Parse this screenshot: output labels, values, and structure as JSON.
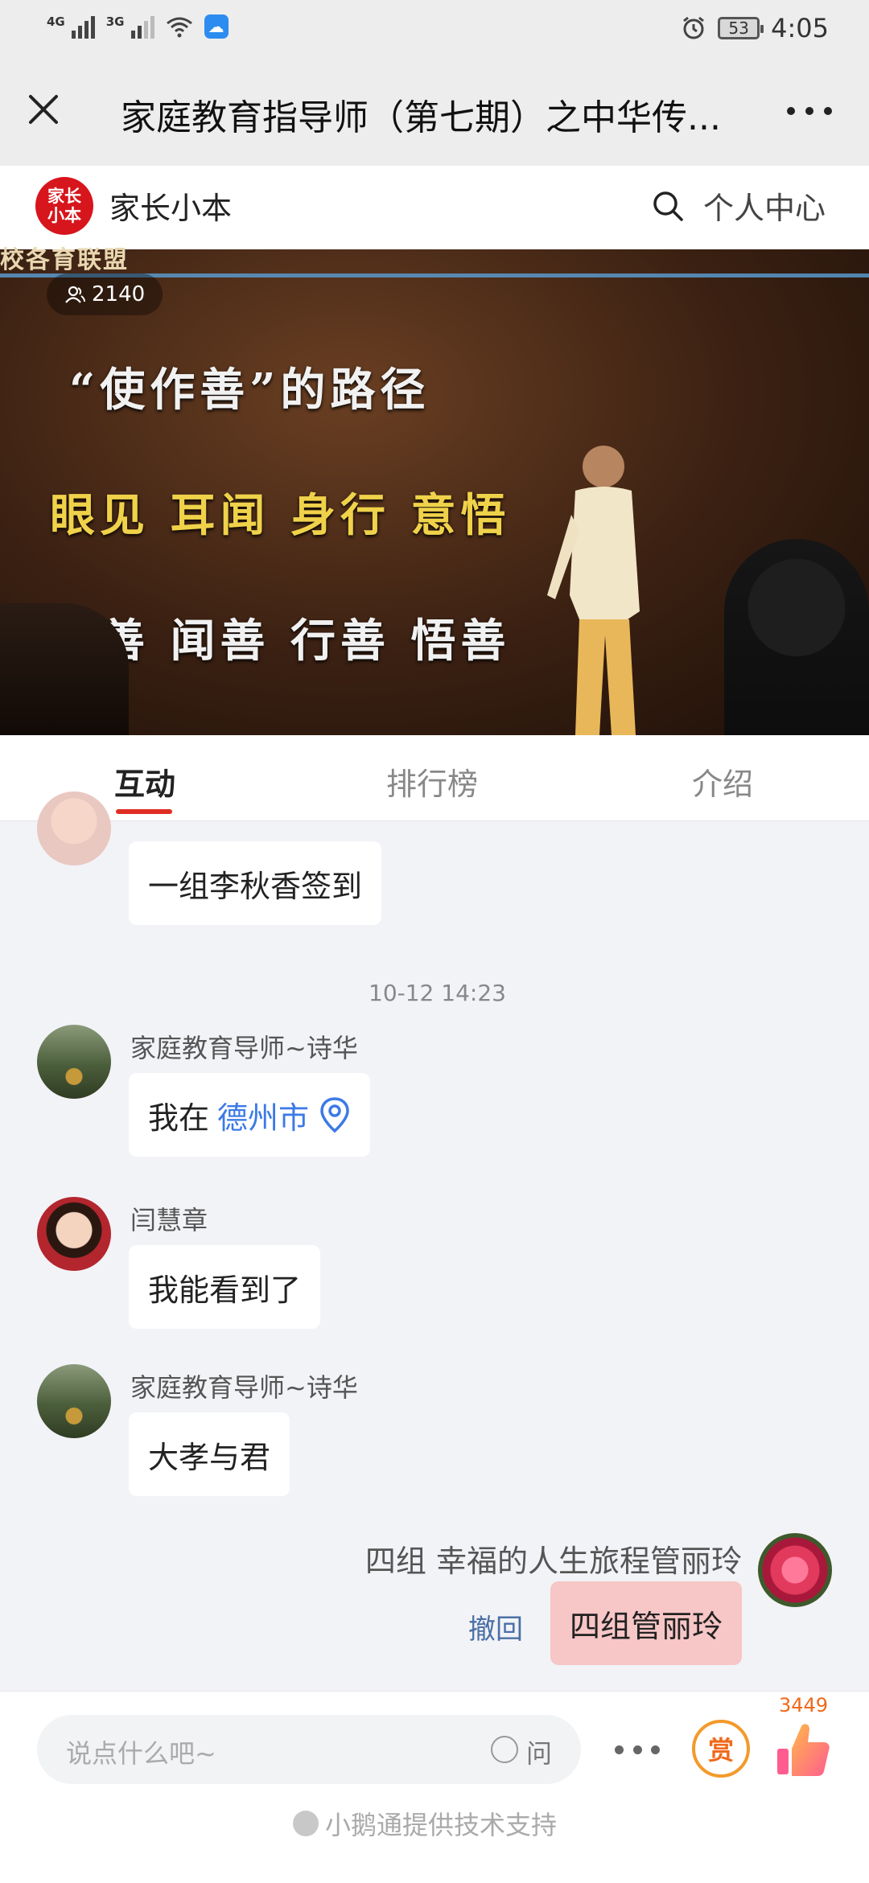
{
  "status_bar": {
    "network_1": "4G",
    "network_2": "3G",
    "battery": "53",
    "time": "4:05"
  },
  "title_bar": {
    "title": "家庭教育指导师（第七期）之中华传..."
  },
  "shop": {
    "logo_text": "家长小本",
    "name": "家长小本",
    "personal_center": "个人中心"
  },
  "video": {
    "viewers": "2140",
    "slide_top": "校各育联盟",
    "slide_line1": "“使作善”的路径",
    "slide_line2": "眼见 耳闻 身行 意悟",
    "slide_line3": "见善 闻善 行善 悟善"
  },
  "tabs": [
    {
      "label": "互动"
    },
    {
      "label": "排行榜"
    },
    {
      "label": "介绍"
    }
  ],
  "chat": {
    "messages": [
      {
        "name": "",
        "text": "一组李秋香签到"
      },
      {
        "timestamp": "10-12 14:23"
      },
      {
        "name": "家庭教育导师~诗华",
        "text": "我在",
        "location": "德州市"
      },
      {
        "name": "闫慧章",
        "text": "我能看到了"
      },
      {
        "name": "家庭教育导师~诗华",
        "text": "大孝与君"
      },
      {
        "name": "四组 幸福的人生旅程管丽玲",
        "text": "四组管丽玲",
        "recall": "撤回"
      }
    ]
  },
  "bottom_bar": {
    "placeholder": "说点什么吧~",
    "ask_label": "问",
    "reward_label": "赏",
    "like_count": "3449",
    "footer": "小鹅通提供技术支持"
  },
  "colors": {
    "accent_red": "#e02e24",
    "link_blue": "#3c7ae6",
    "reward_orange": "#ef6a1c",
    "own_bubble_pink": "#f7c6c6"
  }
}
